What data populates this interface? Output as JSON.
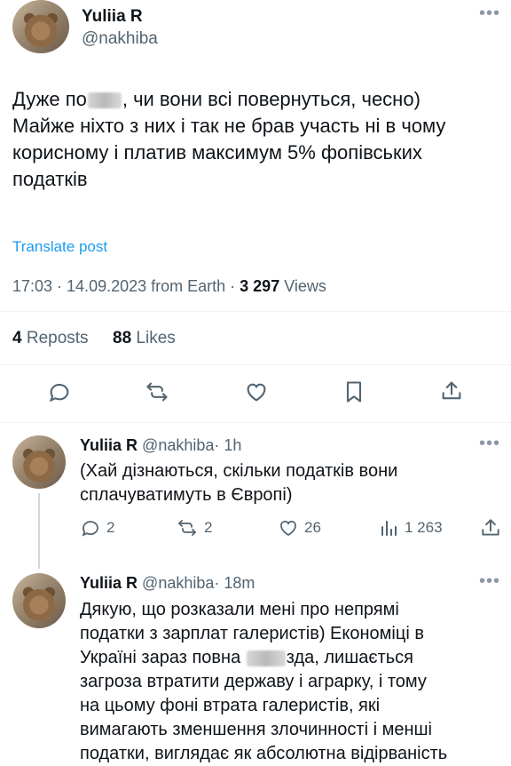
{
  "main_tweet": {
    "author_name": "Yuliia R",
    "author_handle": "@nakhiba",
    "text_line1_a": "Дуже по",
    "text_line1_b": ", чи вони всі повернуться, чесно)",
    "text_line2": "Майже ніхто з них і так не брав участь ні в чому",
    "text_line3": "корисному і платив максимум 5% фопівських",
    "text_line4": "податків",
    "translate_label": "Translate post",
    "timestamp": "17:03 · 14.09.2023 from Earth · ",
    "views_count": "3 297",
    "views_label": " Views",
    "reposts_count": "4",
    "reposts_label": " Reposts",
    "likes_count": "88",
    "likes_label": " Likes"
  },
  "replies": [
    {
      "author_name": "Yuliia R",
      "author_handle": "@nakhiba",
      "time": "· 1h",
      "text_line1": "(Хай дізнаються, скільки податків вони",
      "text_line2": "сплачуватимуть в Європі)",
      "reply_count": "2",
      "repost_count": "2",
      "like_count": "26",
      "view_count": "1 263"
    },
    {
      "author_name": "Yuliia R",
      "author_handle": "@nakhiba",
      "time": "· 18m",
      "text_line1": "Дякую, що розказали мені про непрямі",
      "text_line2": "податки з зарплат галеристів) Економіці в",
      "text_line3_a": "Україні зараз повна ",
      "text_line3_b": "зда, лишається",
      "text_line4": "загроза втратити державу і аграрку, і тому",
      "text_line5": "на цьому фоні втрата галеристів, які",
      "text_line6": "вимагають зменшення злочинності і менші",
      "text_line7": "податки, виглядає як абсолютна відірваність"
    }
  ],
  "colors": {
    "text": "#0f1419",
    "muted": "#536471",
    "link": "#1d9bf0",
    "divider": "#eff3f4"
  }
}
